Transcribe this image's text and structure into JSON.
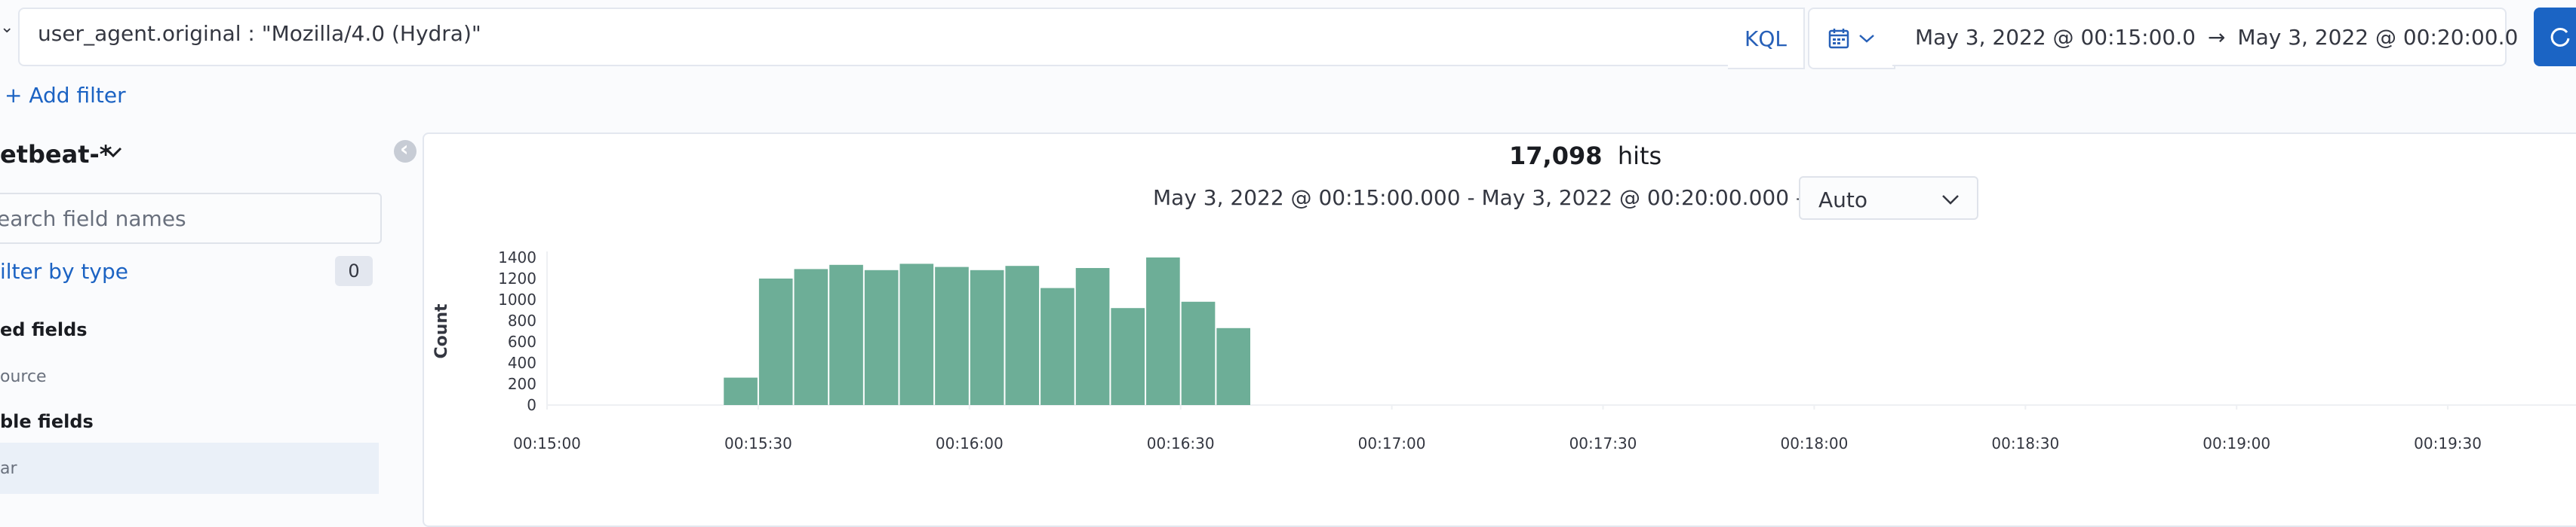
{
  "query_bar": {
    "query": "user_agent.original : \"Mozilla/4.0 (Hydra)\"",
    "language": "KQL",
    "date_start": "May 3, 2022 @ 00:15:00.0",
    "arrow": "→",
    "date_end": "May 3, 2022 @ 00:20:00.0"
  },
  "filters": {
    "add_filter": "+ Add filter"
  },
  "sidebar": {
    "index_pattern": "etbeat-*",
    "search_placeholder": "earch field names",
    "filter_by_type": "ilter by type",
    "filter_count": "0",
    "selected_title": "ed fields",
    "selected_items": [
      "ource"
    ],
    "available_title": "ble fields",
    "available_items": [
      "ar"
    ]
  },
  "main": {
    "hits_count": "17,098",
    "hits_label": "hits",
    "range_label": "May 3, 2022 @ 00:15:00.000 - May 3, 2022 @ 00:20:00.000 —",
    "interval": "Auto"
  },
  "chart_data": {
    "type": "bar",
    "ylabel": "Count",
    "xlabel": "",
    "ylim": [
      0,
      1400
    ],
    "y_ticks": [
      0,
      200,
      400,
      600,
      800,
      1000,
      1200,
      1400
    ],
    "x_ticks": [
      "00:15:00",
      "00:15:30",
      "00:16:00",
      "00:16:30",
      "00:17:00",
      "00:17:30",
      "00:18:00",
      "00:18:30",
      "00:19:00",
      "00:19:30"
    ],
    "bar_interval_seconds": 5,
    "categories": [
      "00:15:25",
      "00:15:30",
      "00:15:35",
      "00:15:40",
      "00:15:45",
      "00:15:50",
      "00:15:55",
      "00:16:00",
      "00:16:05",
      "00:16:10",
      "00:16:15",
      "00:16:20",
      "00:16:25",
      "00:16:30",
      "00:16:35",
      "00:16:40"
    ],
    "values": [
      260,
      1200,
      1290,
      1330,
      1280,
      1340,
      1310,
      1280,
      1320,
      1110,
      1300,
      920,
      1400,
      980,
      730,
      0
    ],
    "color": "#6dae97"
  }
}
